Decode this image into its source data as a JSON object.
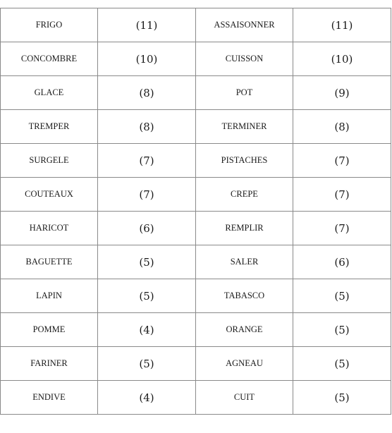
{
  "table": {
    "rows": [
      {
        "left_word": "FRIGO",
        "left_count": "(11)",
        "right_word": "ASSAISONNER",
        "right_count": "(11)"
      },
      {
        "left_word": "CONCOMBRE",
        "left_count": "(10)",
        "right_word": "CUISSON",
        "right_count": "(10)"
      },
      {
        "left_word": "GLACE",
        "left_count": "(8)",
        "right_word": "POT",
        "right_count": "(9)"
      },
      {
        "left_word": "TREMPER",
        "left_count": "(8)",
        "right_word": "TERMINER",
        "right_count": "(8)"
      },
      {
        "left_word": "SURGELE",
        "left_count": "(7)",
        "right_word": "PISTACHES",
        "right_count": "(7)"
      },
      {
        "left_word": "COUTEAUX",
        "left_count": "(7)",
        "right_word": "CREPE",
        "right_count": "(7)"
      },
      {
        "left_word": "HARICOT",
        "left_count": "(6)",
        "right_word": "REMPLIR",
        "right_count": "(7)"
      },
      {
        "left_word": "BAGUETTE",
        "left_count": "(5)",
        "right_word": "SALER",
        "right_count": "(6)"
      },
      {
        "left_word": "LAPIN",
        "left_count": "(5)",
        "right_word": "TABASCO",
        "right_count": "(5)"
      },
      {
        "left_word": "POMME",
        "left_count": "(4)",
        "right_word": "ORANGE",
        "right_count": "(5)"
      },
      {
        "left_word": "FARINER",
        "left_count": "(5)",
        "right_word": "AGNEAU",
        "right_count": "(5)"
      },
      {
        "left_word": "ENDIVE",
        "left_count": "(4)",
        "right_word": "CUIT",
        "right_count": "(5)"
      }
    ]
  }
}
